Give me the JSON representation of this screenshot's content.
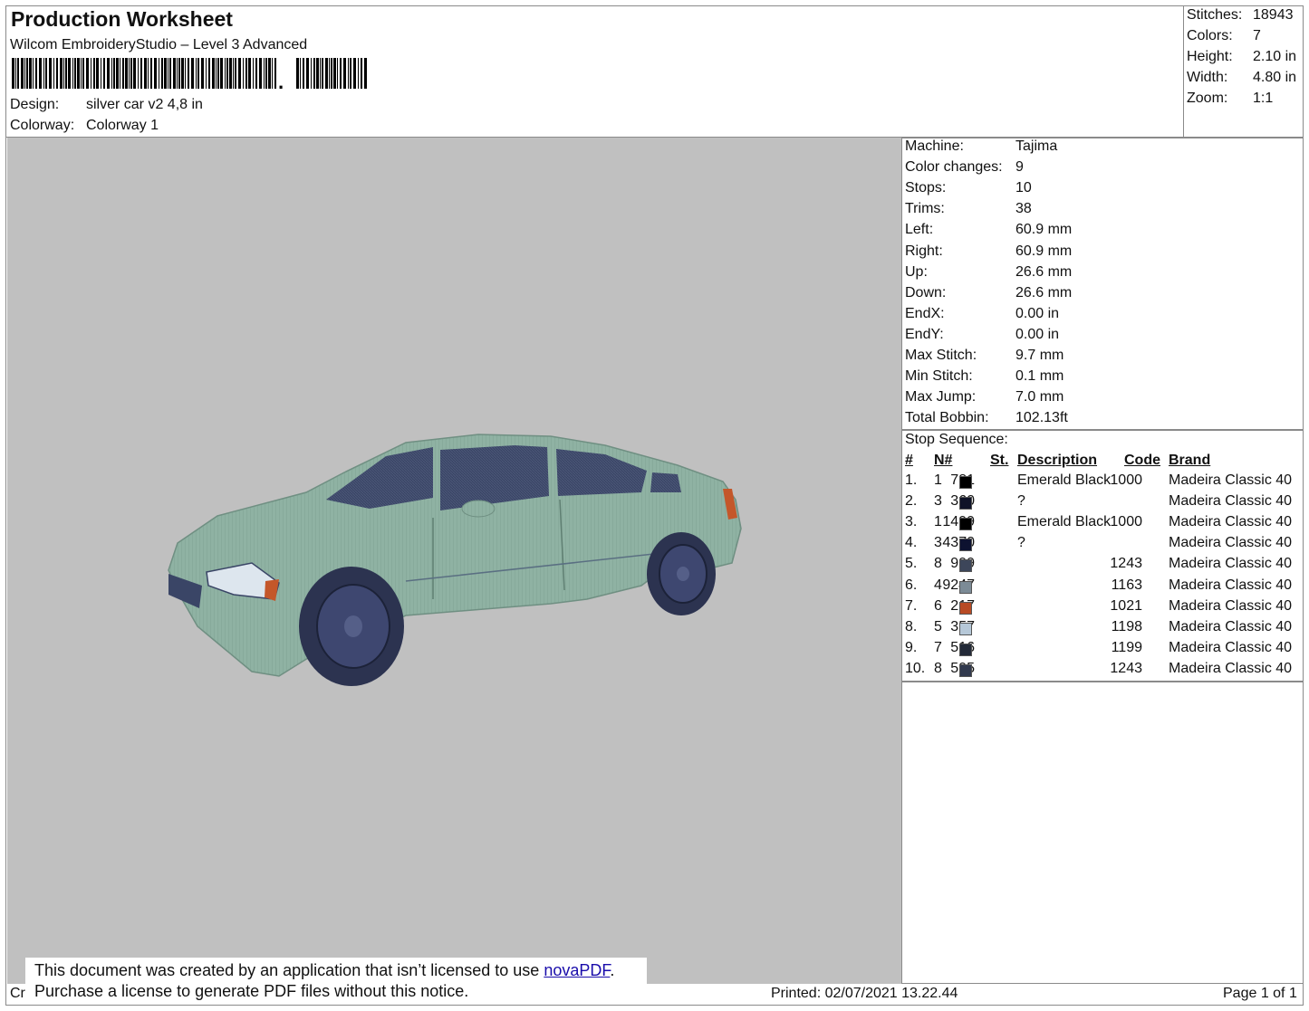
{
  "header": {
    "title": "Production Worksheet",
    "subtitle": "Wilcom EmbroideryStudio – Level 3 Advanced",
    "design_label": "Design:",
    "design_value": "silver car v2 4,8 in",
    "colorway_label": "Colorway:",
    "colorway_value": "Colorway 1"
  },
  "summary": [
    {
      "label": "Stitches:",
      "value": "18943"
    },
    {
      "label": "Colors:",
      "value": "7"
    },
    {
      "label": "Height:",
      "value": "2.10 in"
    },
    {
      "label": "Width:",
      "value": "4.80 in"
    },
    {
      "label": "Zoom:",
      "value": "1:1"
    }
  ],
  "machine_info": [
    {
      "label": "Machine:",
      "value": "Tajima"
    },
    {
      "label": "Color changes:",
      "value": "9"
    },
    {
      "label": "Stops:",
      "value": "10"
    },
    {
      "label": "Trims:",
      "value": "38"
    },
    {
      "label": "Left:",
      "value": "60.9 mm"
    },
    {
      "label": "Right:",
      "value": "60.9 mm"
    },
    {
      "label": "Up:",
      "value": "26.6 mm"
    },
    {
      "label": "Down:",
      "value": "26.6 mm"
    },
    {
      "label": "EndX:",
      "value": "0.00 in"
    },
    {
      "label": "EndY:",
      "value": "0.00 in"
    },
    {
      "label": "Max Stitch:",
      "value": "9.7 mm"
    },
    {
      "label": "Min Stitch:",
      "value": "0.1 mm"
    },
    {
      "label": "Max Jump:",
      "value": "7.0 mm"
    },
    {
      "label": "Total Bobbin:",
      "value": "102.13ft"
    }
  ],
  "stop_sequence": {
    "title": "Stop Sequence:",
    "columns": {
      "idx": "#",
      "needle": "N#",
      "st": "St.",
      "desc": "Description",
      "code": "Code",
      "brand": "Brand"
    },
    "rows": [
      {
        "idx": "1.",
        "needle": "1",
        "color": "#000000",
        "st": "781",
        "desc": "Emerald Black",
        "code": "1000",
        "brand": "Madeira Classic 40"
      },
      {
        "idx": "2.",
        "needle": "3",
        "color": "#0f1328",
        "st": "360",
        "desc": "?",
        "code": "",
        "brand": "Madeira Classic 40"
      },
      {
        "idx": "3.",
        "needle": "1",
        "color": "#000000",
        "st": "1499",
        "desc": "Emerald Black",
        "code": "1000",
        "brand": "Madeira Classic 40"
      },
      {
        "idx": "4.",
        "needle": "3",
        "color": "#0d1230",
        "st": "4370",
        "desc": "?",
        "code": "",
        "brand": "Madeira Classic 40"
      },
      {
        "idx": "5.",
        "needle": "8",
        "color": "#3d465a",
        "st": "999",
        "desc": "",
        "code": "1243",
        "brand": "Madeira Classic 40"
      },
      {
        "idx": "6.",
        "needle": "4",
        "color": "#7c8b96",
        "st": "9247",
        "desc": "",
        "code": "1163",
        "brand": "Madeira Classic 40"
      },
      {
        "idx": "7.",
        "needle": "6",
        "color": "#b84a24",
        "st": "217",
        "desc": "",
        "code": "1021",
        "brand": "Madeira Classic 40"
      },
      {
        "idx": "8.",
        "needle": "5",
        "color": "#b6c8d8",
        "st": "357",
        "desc": "",
        "code": "1198",
        "brand": "Madeira Classic 40"
      },
      {
        "idx": "9.",
        "needle": "7",
        "color": "#232a38",
        "st": "516",
        "desc": "",
        "code": "1199",
        "brand": "Madeira Classic 40"
      },
      {
        "idx": "10.",
        "needle": "8",
        "color": "#323a4e",
        "st": "595",
        "desc": "",
        "code": "1243",
        "brand": "Madeira Classic 40"
      }
    ]
  },
  "footer": {
    "created_prefix": "Cr",
    "notice_line1": "This document was created by an application that isn’t licensed to use ",
    "notice_link": "novaPDF",
    "notice_line1_end": ".",
    "notice_line2": "Purchase a license to generate PDF files without this notice.",
    "printed": "Printed: 02/07/2021 13.22.44",
    "page": "Page 1 of 1"
  },
  "colors": {
    "design_bg": "#c0c0c0",
    "car_body": "#8fb2a3",
    "car_glass": "#3a4566",
    "tire": "#2c3350",
    "indicator": "#c4572a"
  }
}
